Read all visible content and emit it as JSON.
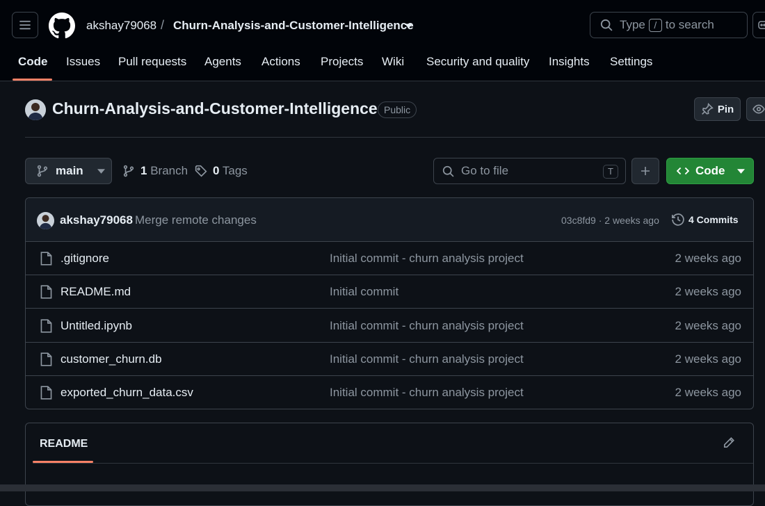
{
  "header": {
    "owner": "akshay79068",
    "separator": "/",
    "repo": "Churn-Analysis-and-Customer-Intelligence",
    "search": {
      "type_label": "Type",
      "key": "/",
      "suffix": "to search"
    }
  },
  "tabs": [
    {
      "label": "Code",
      "active": true
    },
    {
      "label": "Issues"
    },
    {
      "label": "Pull requests"
    },
    {
      "label": "Agents"
    },
    {
      "label": "Actions"
    },
    {
      "label": "Projects"
    },
    {
      "label": "Wiki"
    },
    {
      "label": "Security and quality"
    },
    {
      "label": "Insights"
    },
    {
      "label": "Settings"
    }
  ],
  "repo": {
    "title": "Churn-Analysis-and-Customer-Intelligence",
    "visibility": "Public",
    "pin_label": "Pin"
  },
  "toolbar": {
    "branch": "main",
    "branch_count": "1",
    "branch_label": "Branch",
    "tag_count": "0",
    "tag_label": "Tags",
    "goto_placeholder": "Go to file",
    "goto_key": "T",
    "code_label": "Code"
  },
  "latest_commit": {
    "author": "akshay79068",
    "message": "Merge remote changes",
    "meta": "03c8fd9 · 2 weeks ago",
    "commits_label": "4 Commits"
  },
  "files": [
    {
      "name": ".gitignore",
      "commit": "Initial commit - churn analysis project",
      "date": "2 weeks ago"
    },
    {
      "name": "README.md",
      "commit": "Initial commit",
      "date": "2 weeks ago"
    },
    {
      "name": "Untitled.ipynb",
      "commit": "Initial commit - churn analysis project",
      "date": "2 weeks ago"
    },
    {
      "name": "customer_churn.db",
      "commit": "Initial commit - churn analysis project",
      "date": "2 weeks ago"
    },
    {
      "name": "exported_churn_data.csv",
      "commit": "Initial commit - churn analysis project",
      "date": "2 weeks ago"
    }
  ],
  "readme": {
    "title": "README"
  },
  "colors": {
    "accent_underline": "#f78166",
    "code_button": "#238636",
    "background": "#0d1117"
  }
}
